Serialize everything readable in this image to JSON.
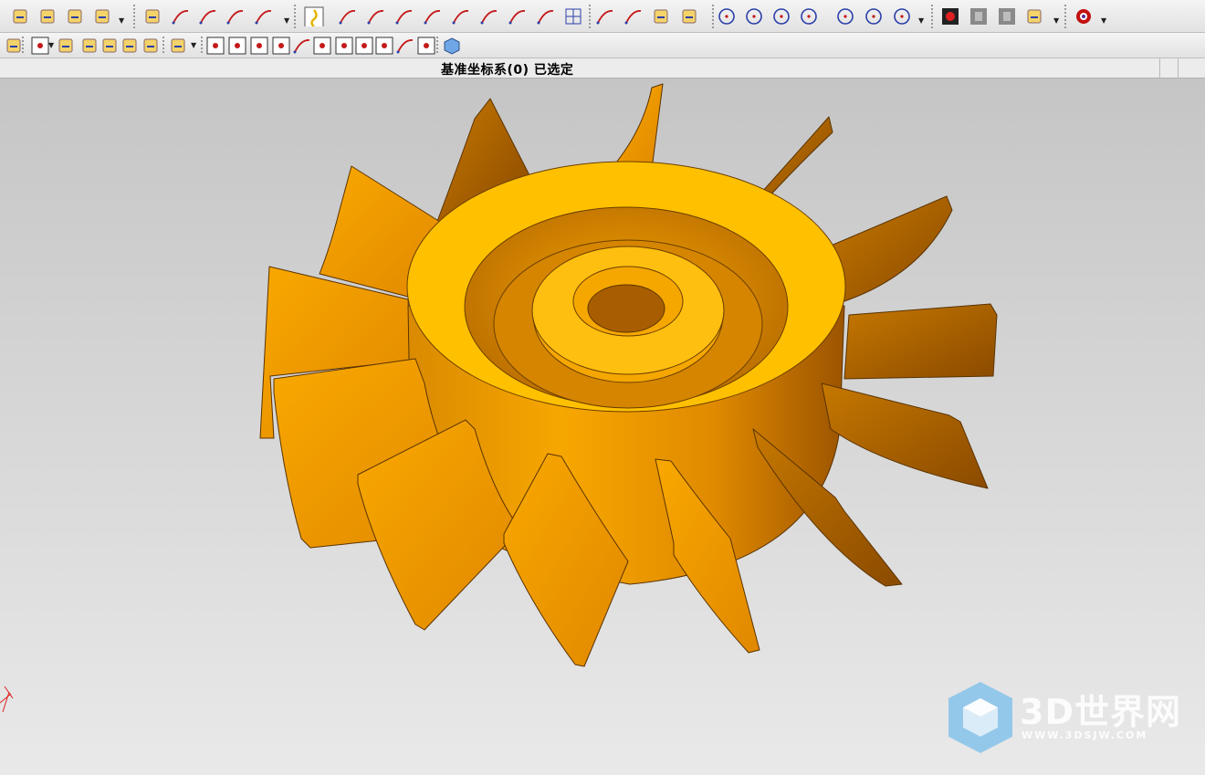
{
  "status_bar": {
    "message": "基准坐标系(0) 已选定"
  },
  "toolbar_row1": {
    "icons": [
      "sketch-icon",
      "extrude-icon",
      "cylinder-icon",
      "revolve-icon",
      "analysis-icon",
      "curve-tool-icon",
      "bridge-curve-icon",
      "offset-curve-icon",
      "fillet-curve-icon",
      "lasso-select-icon",
      "line-icon",
      "axis-line-icon",
      "parallel-line-icon",
      "cross-line-icon",
      "point-line-icon",
      "tangent-curve-icon",
      "spline-icon",
      "trim-curve-icon",
      "grid-icon",
      "arc-icon",
      "arc-3pt-icon",
      "bracket-icon",
      "corner-icon",
      "circle-icon",
      "circle-point-icon",
      "circle-square-icon",
      "circle-tangent-icon",
      "circle-center-icon",
      "circle-radius-icon",
      "circle-arc-icon",
      "record-icon",
      "pause-icon",
      "stop-icon",
      "report-icon",
      "wheel-icon"
    ]
  },
  "toolbar_row2": {
    "icons": [
      "view-icon",
      "snap-box-icon",
      "undo-arrow-icon",
      "eraser-icon",
      "move-icon",
      "transform-icon",
      "route-icon",
      "rect-select-icon",
      "point-snap-icon",
      "multi-snap-icon",
      "endpoint-snap-icon",
      "midpoint-snap-icon",
      "curve-snap-icon",
      "intersect-snap-icon",
      "center-snap-icon",
      "quadrant-snap-icon",
      "existing-point-icon",
      "on-curve-icon",
      "face-snap-icon",
      "cube-icon"
    ]
  },
  "watermark": {
    "brand": "3D世界网",
    "url": "WWW.3DSJW.COM"
  },
  "colors": {
    "part": "#f5a800",
    "part_dark": "#c26b00",
    "part_light": "#ffc21a",
    "edge": "#5a3300"
  }
}
